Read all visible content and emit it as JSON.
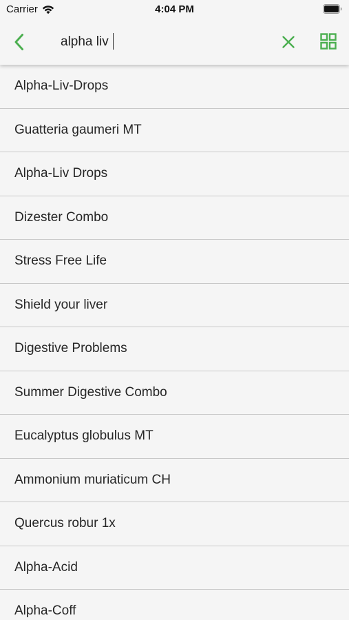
{
  "status_bar": {
    "carrier": "Carrier",
    "time": "4:04 PM"
  },
  "search": {
    "value": "alpha liv",
    "accent_color": "#4caf50"
  },
  "icons": {
    "back": "chevron-left-icon",
    "clear": "close-icon",
    "view": "grid-view-icon"
  },
  "results": [
    "Alpha-Liv-Drops",
    "Guatteria gaumeri MT",
    "Alpha-Liv Drops",
    "Dizester Combo",
    "Stress Free Life",
    "Shield your liver",
    "Digestive Problems",
    "Summer Digestive Combo",
    "Eucalyptus globulus MT",
    "Ammonium muriaticum CH",
    "Quercus robur 1x",
    "Alpha-Acid",
    "Alpha-Coff"
  ]
}
